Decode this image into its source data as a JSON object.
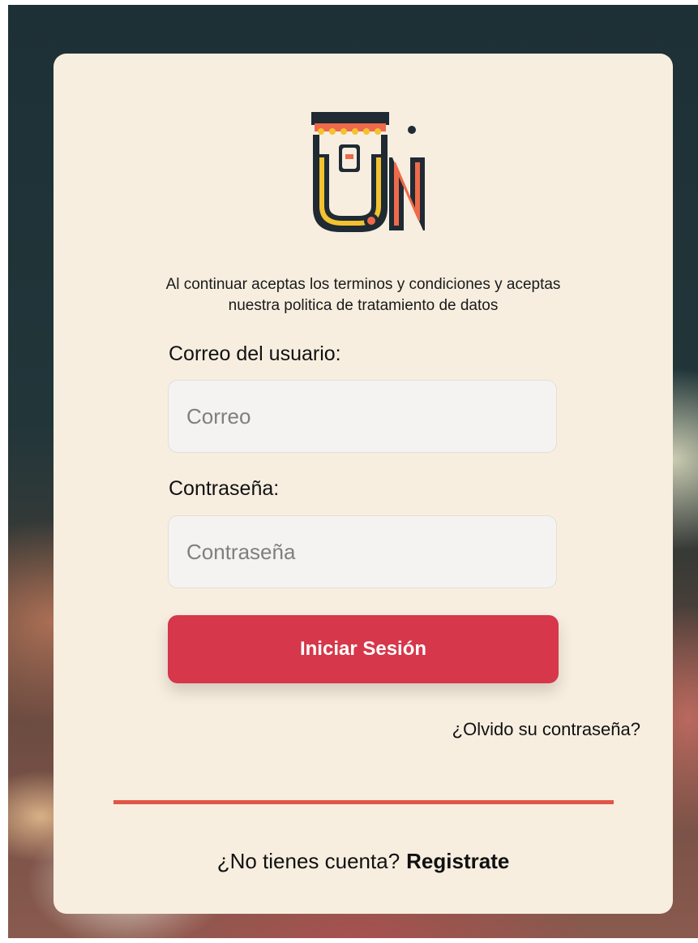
{
  "terms_text_line1": "Al continuar aceptas los terminos y condiciones y aceptas",
  "terms_text_line2": "nuestra politica de tratamiento de datos",
  "login_form": {
    "email_label": "Correo del usuario:",
    "email_placeholder": "Correo",
    "email_value": "",
    "password_label": "Contraseña:",
    "password_placeholder": "Contraseña",
    "password_value": "",
    "submit_label": "Iniciar Sesión",
    "forgot_label": "¿Olvido su contraseña?"
  },
  "register": {
    "prompt": "¿No tienes cuenta?",
    "link_label": "Registrate"
  },
  "logo": {
    "icon": "store-awning-logo-icon",
    "letters": "UN"
  },
  "colors": {
    "card_background": "#f7eee0",
    "primary_button": "#d6374a",
    "divider": "#e05545",
    "logo_dark": "#1f2a33",
    "logo_yellow": "#f2c230",
    "logo_coral": "#ee6a4a"
  }
}
